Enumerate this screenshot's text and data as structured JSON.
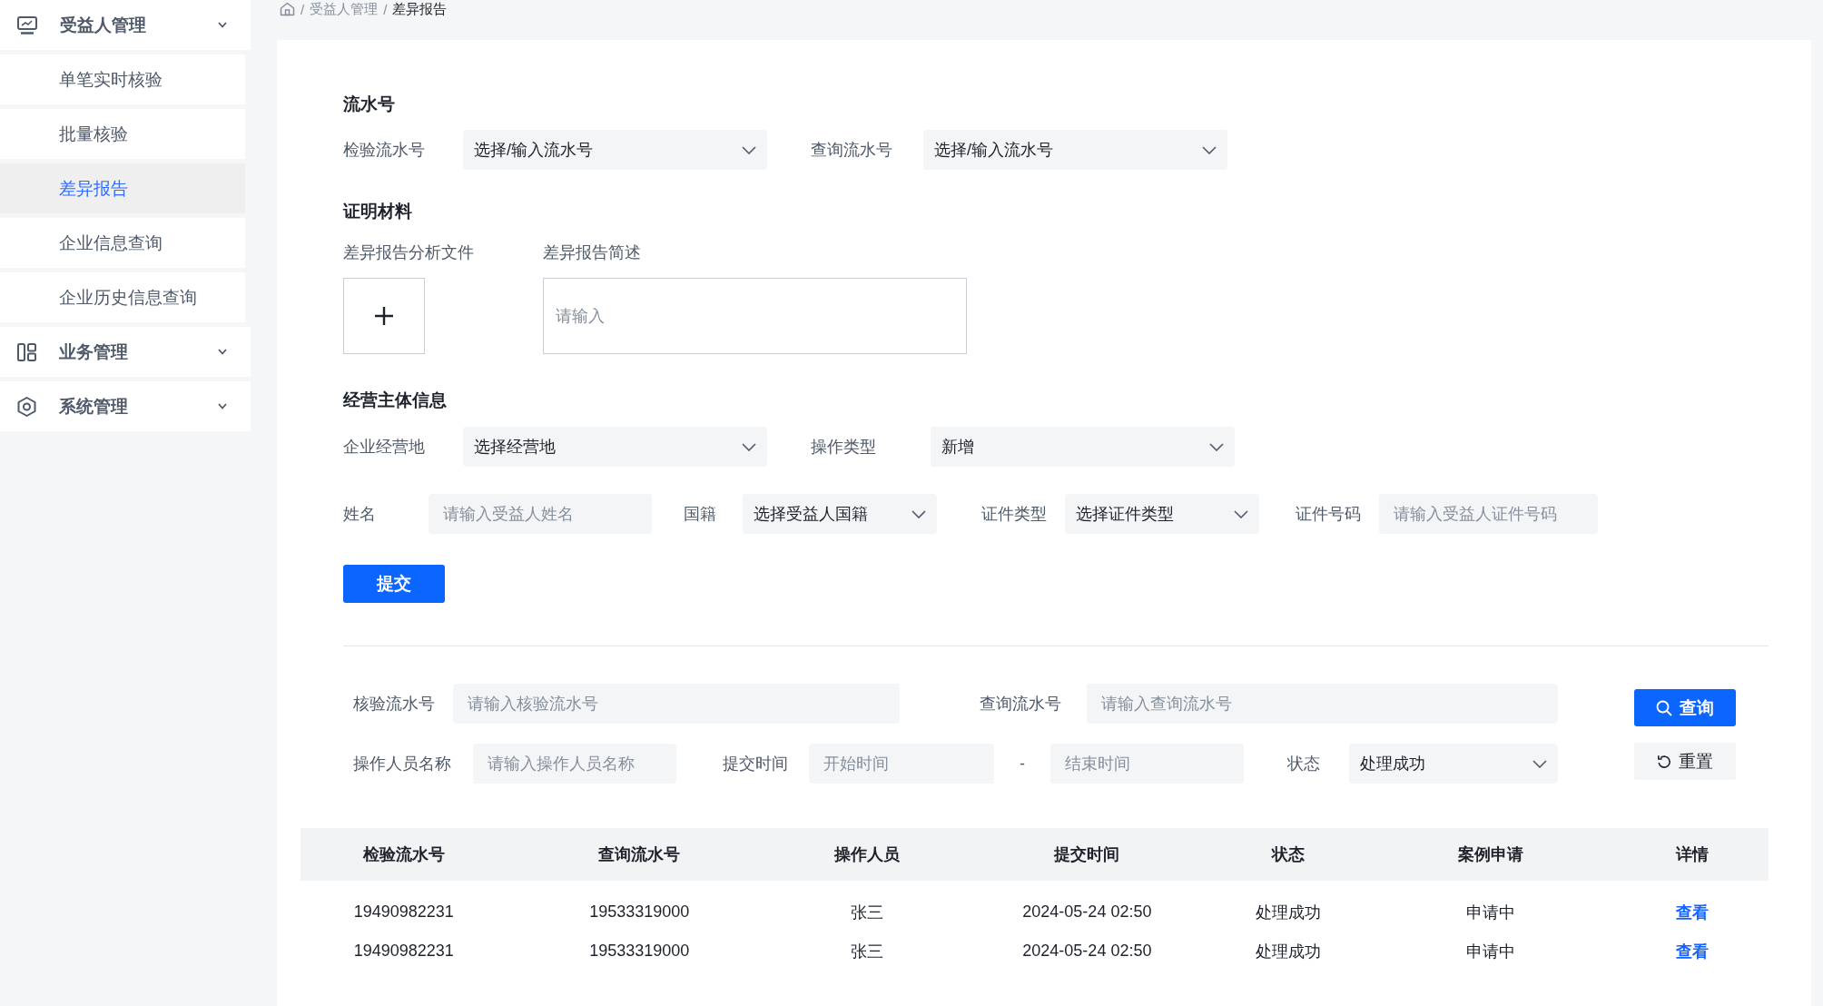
{
  "sidebar": {
    "groups": [
      {
        "label": "受益人管理",
        "children": [
          {
            "label": "单笔实时核验",
            "selected": false
          },
          {
            "label": "批量核验",
            "selected": false
          },
          {
            "label": "差异报告",
            "selected": true
          },
          {
            "label": "企业信息查询",
            "selected": false
          },
          {
            "label": "企业历史信息查询",
            "selected": false
          }
        ]
      },
      {
        "label": "业务管理"
      },
      {
        "label": "系统管理"
      }
    ]
  },
  "breadcrumb": {
    "separator": "/",
    "items": [
      "受益人管理",
      "差异报告"
    ]
  },
  "form": {
    "serial_section": {
      "title": "流水号",
      "fields": [
        {
          "kind": "select",
          "label": "检验流水号",
          "value": "选择/输入流水号"
        },
        {
          "kind": "select",
          "label": "查询流水号",
          "value": "选择/输入流水号"
        }
      ]
    },
    "evidence_section": {
      "title": "证明材料",
      "upload": {
        "label": "差异报告分析文件"
      },
      "description": {
        "label": "差异报告简述",
        "placeholder": "请输入"
      }
    },
    "entity_section": {
      "title": "经营主体信息",
      "rows": [
        {
          "fields": [
            {
              "kind": "select",
              "label": "企业经营地",
              "value": "选择经营地"
            },
            {
              "kind": "select",
              "label": "操作类型",
              "value": "新增"
            }
          ]
        },
        {
          "fields": [
            {
              "kind": "input",
              "label": "姓名",
              "placeholder": "请输入受益人姓名"
            },
            {
              "kind": "select",
              "label": "国籍",
              "value": "选择受益人国籍"
            },
            {
              "kind": "select",
              "label": "证件类型",
              "value": "选择证件类型"
            },
            {
              "kind": "input",
              "label": "证件号码",
              "placeholder": "请输入受益人证件号码"
            }
          ]
        }
      ]
    },
    "submit_button": {
      "label": "提交"
    }
  },
  "filter": {
    "rows": [
      {
        "fields": [
          {
            "kind": "input",
            "label": "核验流水号",
            "placeholder": "请输入核验流水号"
          },
          {
            "kind": "input",
            "label": "查询流水号",
            "placeholder": "请输入查询流水号"
          }
        ]
      },
      {
        "fields": [
          {
            "kind": "input",
            "label": "操作人员名称",
            "placeholder": "请输入操作人员名称"
          },
          {
            "kind": "range",
            "label": "提交时间",
            "start_placeholder": "开始时间",
            "separator": "-",
            "end_placeholder": "结束时间"
          },
          {
            "kind": "select",
            "label": "状态",
            "value": "处理成功"
          }
        ]
      }
    ],
    "search_button": {
      "label": "查询"
    },
    "reset_button": {
      "label": "重置"
    }
  },
  "table": {
    "columns": [
      {
        "label": "检验流水号",
        "kind": "text"
      },
      {
        "label": "查询流水号",
        "kind": "text"
      },
      {
        "label": "操作人员",
        "kind": "text"
      },
      {
        "label": "提交时间",
        "kind": "text"
      },
      {
        "label": "状态",
        "kind": "text"
      },
      {
        "label": "案例申请",
        "kind": "text"
      },
      {
        "label": "详情",
        "kind": "link"
      }
    ],
    "rows": [
      {
        "cells": [
          "19490982231",
          "19533319000",
          "张三",
          "2024-05-24 02:50",
          "处理成功",
          "申请中",
          "查看"
        ]
      },
      {
        "cells": [
          "19490982231",
          "19533319000",
          "张三",
          "2024-05-24 02:50",
          "处理成功",
          "申请中",
          "查看"
        ]
      }
    ]
  }
}
